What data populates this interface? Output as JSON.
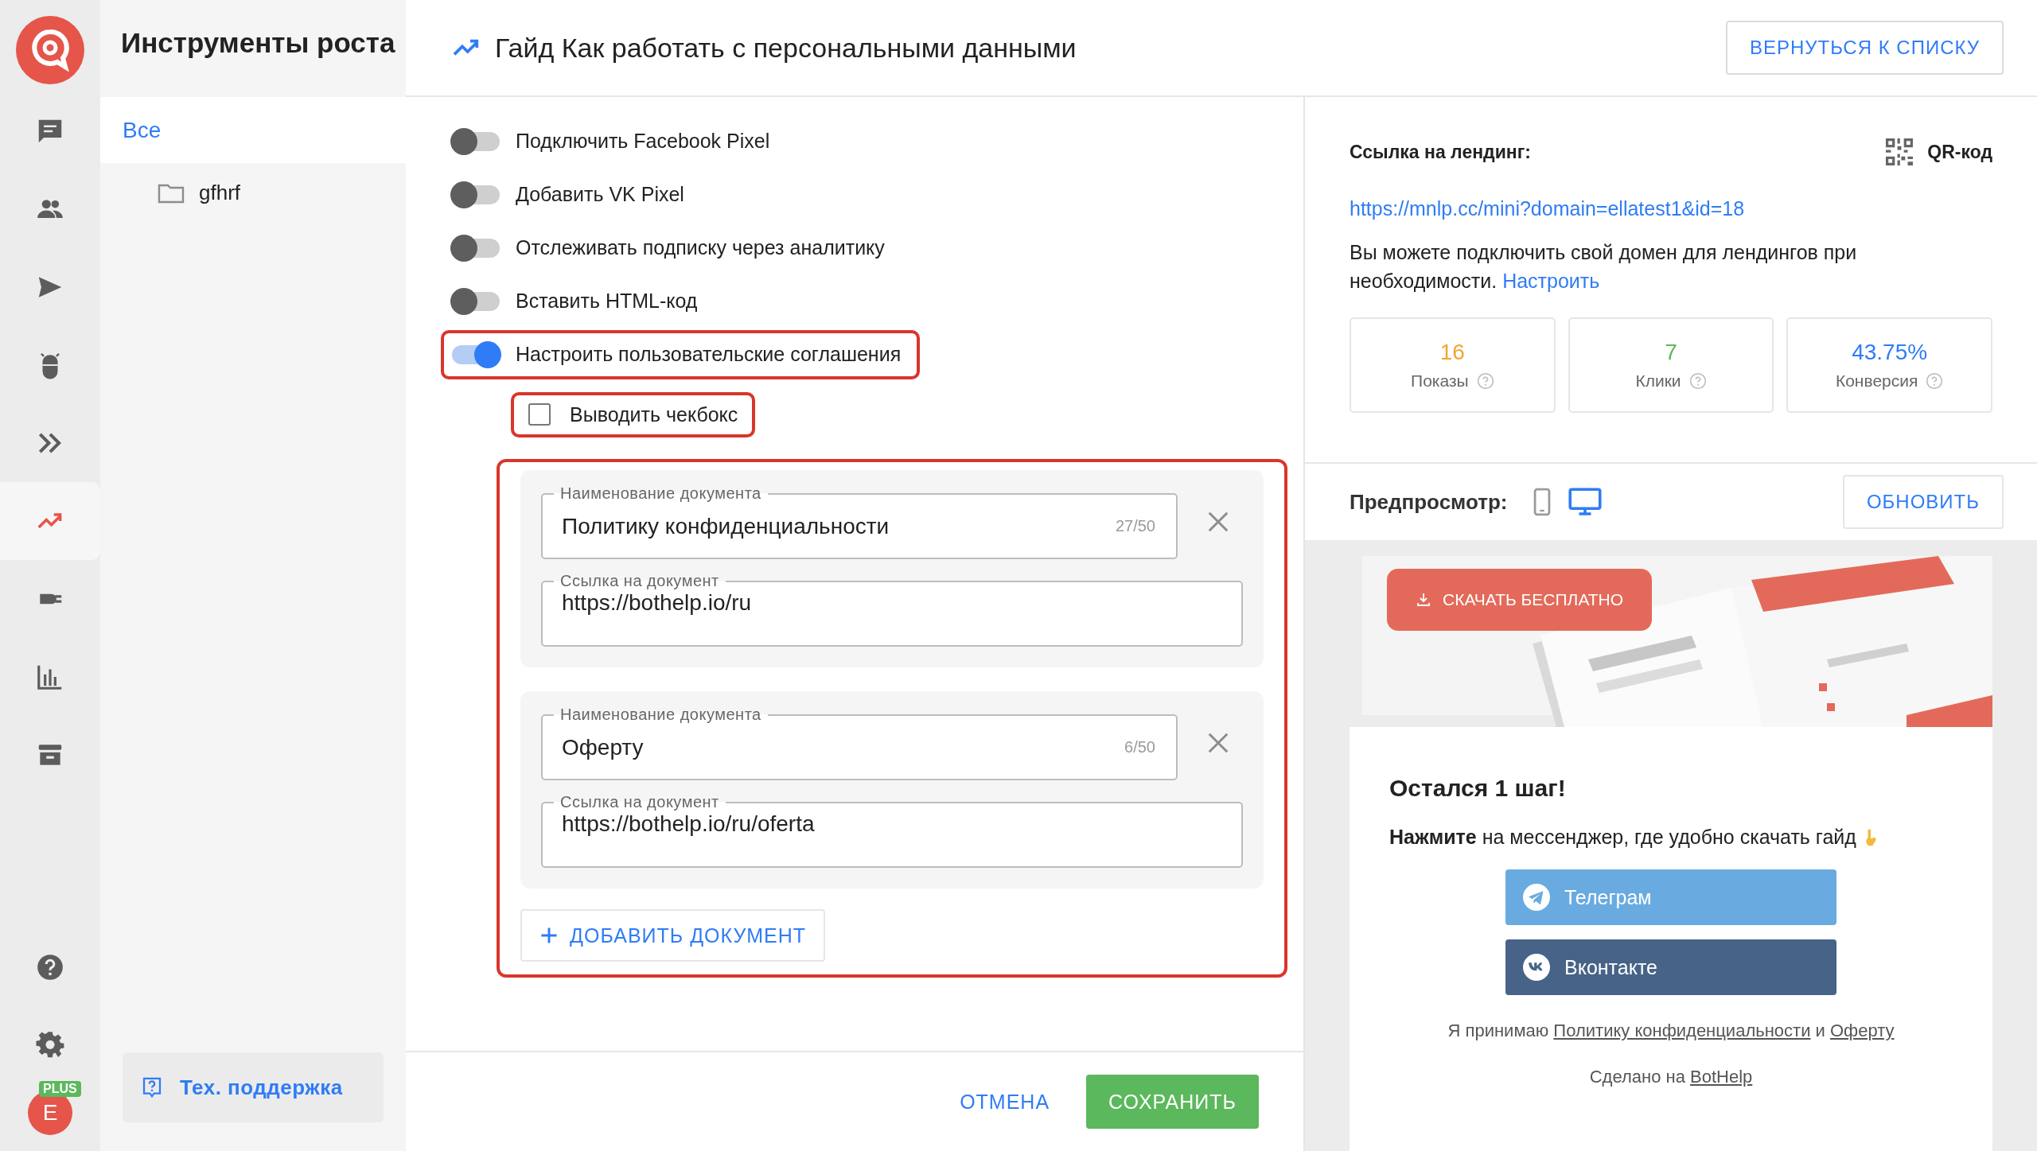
{
  "rail": {
    "items": [
      {
        "selected": false
      },
      {
        "selected": false
      },
      {
        "selected": false
      },
      {
        "selected": false
      },
      {
        "selected": false
      },
      {
        "selected": true
      },
      {
        "selected": false
      },
      {
        "selected": false
      },
      {
        "selected": false
      }
    ],
    "avatar": {
      "letter": "E",
      "badge": "PLUS"
    }
  },
  "sidebar": {
    "title": "Инструменты роста",
    "items": [
      {
        "label": "Все",
        "kind": "all",
        "selected": true
      },
      {
        "label": "gfhrf",
        "kind": "folder",
        "selected": false
      }
    ],
    "support": "Тех. поддержка"
  },
  "header": {
    "title": "Гайд Как работать с персональными данными",
    "back_button": "ВЕРНУТЬСЯ К СПИСКУ"
  },
  "settings": {
    "toggles": [
      {
        "label": "Подключить Facebook Pixel",
        "on": false,
        "highlighted": false
      },
      {
        "label": "Добавить VK Pixel",
        "on": false,
        "highlighted": false
      },
      {
        "label": "Отслеживать подписку через аналитику",
        "on": false,
        "highlighted": false
      },
      {
        "label": "Вставить HTML-код",
        "on": false,
        "highlighted": false
      },
      {
        "label": "Настроить пользовательские соглашения",
        "on": true,
        "highlighted": true
      }
    ],
    "checkbox": {
      "label": "Выводить чекбокс",
      "checked": false,
      "highlighted": true
    },
    "documents": {
      "highlighted": true,
      "items": [
        {
          "name_label": "Наименование документа",
          "name": "Политику конфиденциальности",
          "counter": "27/50",
          "link_label": "Ссылка на документ",
          "link": "https://bothelp.io/ru"
        },
        {
          "name_label": "Наименование документа",
          "name": "Оферту",
          "counter": "6/50",
          "link_label": "Ссылка на документ",
          "link": "https://bothelp.io/ru/oferta"
        }
      ],
      "add_button": "ДОБАВИТЬ ДОКУМЕНТ"
    }
  },
  "footer": {
    "cancel": "ОТМЕНА",
    "save": "СОХРАНИТЬ"
  },
  "landing": {
    "label": "Ссылка на лендинг:",
    "qr": "QR-код",
    "url": "https://mnlp.cc/mini?domain=ellatest1&id=18",
    "note": "Вы можете подключить свой домен для лендингов при необходимости.",
    "note_link": "Настроить",
    "stats": [
      {
        "value": "16",
        "label": "Показы",
        "color": "#f0a630"
      },
      {
        "value": "7",
        "label": "Клики",
        "color": "#5cb85c"
      },
      {
        "value": "43.75%",
        "label": "Конверсия",
        "color": "#2f7cf6"
      }
    ]
  },
  "preview": {
    "label": "Предпросмотр:",
    "devices": [
      {
        "selected": false
      },
      {
        "selected": true
      }
    ],
    "refresh": "ОБНОВИТЬ",
    "banner": {
      "kind": "picture",
      "button": "СКАЧАТЬ БЕСПЛАТНО"
    },
    "heading": "Остался 1 шаг!",
    "instruction": "**Нажмите** на мессенджер, где удобно скачать гайд",
    "messengers": [
      {
        "label": "Телеграм",
        "color": "#69abe0"
      },
      {
        "label": "Вконтакте",
        "color": "#476387"
      }
    ],
    "consent": {
      "text": "Я принимаю",
      "joiner": "и",
      "links": [
        "Политику конфиденциальности",
        "Оферту"
      ]
    },
    "made_with": {
      "text": "Сделано на",
      "link": "BotHelp"
    }
  }
}
